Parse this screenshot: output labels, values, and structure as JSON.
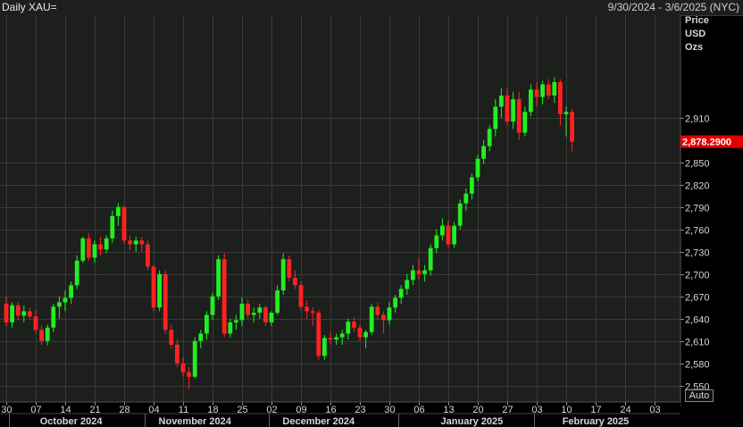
{
  "header": {
    "title": "Daily XAU=",
    "date_range": "9/30/2024 - 3/6/2025 (NYC)"
  },
  "price_axis": {
    "label_lines": [
      "Price",
      "USD",
      "Ozs"
    ]
  },
  "auto_label": "Auto",
  "chart_data": {
    "type": "candlestick",
    "instrument": "XAU=",
    "unit": "USD/Ozs",
    "last_price": "2,878.2900",
    "ylim": [
      2528,
      3048
    ],
    "y_ticks": [
      2550,
      2580,
      2610,
      2640,
      2670,
      2700,
      2730,
      2760,
      2790,
      2820,
      2850,
      2910
    ],
    "y_tick_labels": [
      "2,550",
      "2,580",
      "2,610",
      "2,640",
      "2,670",
      "2,700",
      "2,730",
      "2,760",
      "2,790",
      "2,820",
      "2,850",
      "2,910"
    ],
    "x_day_ticks": [
      {
        "label": "30",
        "index": 0
      },
      {
        "label": "07",
        "index": 5
      },
      {
        "label": "14",
        "index": 10
      },
      {
        "label": "21",
        "index": 15
      },
      {
        "label": "28",
        "index": 20
      },
      {
        "label": "04",
        "index": 25
      },
      {
        "label": "11",
        "index": 30
      },
      {
        "label": "18",
        "index": 35
      },
      {
        "label": "25",
        "index": 40
      },
      {
        "label": "02",
        "index": 45
      },
      {
        "label": "09",
        "index": 50
      },
      {
        "label": "16",
        "index": 55
      },
      {
        "label": "23",
        "index": 60
      },
      {
        "label": "30",
        "index": 65
      },
      {
        "label": "06",
        "index": 70
      },
      {
        "label": "13",
        "index": 75
      },
      {
        "label": "20",
        "index": 80
      },
      {
        "label": "27",
        "index": 85
      },
      {
        "label": "03",
        "index": 90
      },
      {
        "label": "10",
        "index": 95
      },
      {
        "label": "17",
        "index": 100
      },
      {
        "label": "24",
        "index": 105
      },
      {
        "label": "03",
        "index": 110
      }
    ],
    "x_months": [
      {
        "label": "October 2024",
        "index": 11
      },
      {
        "label": "November 2024",
        "index": 32
      },
      {
        "label": "December 2024",
        "index": 53
      },
      {
        "label": "January 2025",
        "index": 79
      },
      {
        "label": "February 2025",
        "index": 100
      }
    ],
    "month_boundaries": [
      1,
      24,
      45,
      67,
      90
    ],
    "colors": {
      "up": "#22ee22",
      "down": "#ff2222",
      "last_price_bg": "#e00000",
      "grid": "#3a3a3a"
    },
    "ohlc": [
      [
        2660,
        2670,
        2630,
        2635
      ],
      [
        2635,
        2662,
        2628,
        2658
      ],
      [
        2658,
        2662,
        2638,
        2644
      ],
      [
        2644,
        2658,
        2635,
        2650
      ],
      [
        2650,
        2655,
        2640,
        2643
      ],
      [
        2643,
        2652,
        2620,
        2625
      ],
      [
        2625,
        2632,
        2605,
        2610
      ],
      [
        2610,
        2632,
        2604,
        2628
      ],
      [
        2628,
        2660,
        2622,
        2656
      ],
      [
        2656,
        2670,
        2640,
        2662
      ],
      [
        2662,
        2678,
        2650,
        2668
      ],
      [
        2668,
        2690,
        2660,
        2685
      ],
      [
        2685,
        2725,
        2680,
        2718
      ],
      [
        2718,
        2750,
        2715,
        2748
      ],
      [
        2748,
        2755,
        2718,
        2722
      ],
      [
        2722,
        2745,
        2715,
        2740
      ],
      [
        2740,
        2750,
        2725,
        2733
      ],
      [
        2733,
        2752,
        2728,
        2748
      ],
      [
        2748,
        2785,
        2742,
        2778
      ],
      [
        2778,
        2795,
        2765,
        2790
      ],
      [
        2790,
        2792,
        2740,
        2745
      ],
      [
        2745,
        2752,
        2732,
        2740
      ],
      [
        2740,
        2750,
        2730,
        2745
      ],
      [
        2745,
        2750,
        2730,
        2740
      ],
      [
        2740,
        2745,
        2705,
        2710
      ],
      [
        2710,
        2712,
        2650,
        2655
      ],
      [
        2655,
        2705,
        2650,
        2700
      ],
      [
        2700,
        2705,
        2620,
        2625
      ],
      [
        2625,
        2632,
        2600,
        2605
      ],
      [
        2605,
        2612,
        2575,
        2580
      ],
      [
        2580,
        2588,
        2562,
        2568
      ],
      [
        2568,
        2575,
        2545,
        2562
      ],
      [
        2562,
        2615,
        2560,
        2610
      ],
      [
        2610,
        2625,
        2600,
        2620
      ],
      [
        2620,
        2650,
        2612,
        2645
      ],
      [
        2645,
        2675,
        2638,
        2670
      ],
      [
        2670,
        2725,
        2665,
        2720
      ],
      [
        2720,
        2728,
        2615,
        2620
      ],
      [
        2620,
        2640,
        2615,
        2635
      ],
      [
        2635,
        2645,
        2625,
        2638
      ],
      [
        2638,
        2668,
        2630,
        2660
      ],
      [
        2660,
        2665,
        2640,
        2645
      ],
      [
        2645,
        2655,
        2635,
        2648
      ],
      [
        2648,
        2660,
        2640,
        2655
      ],
      [
        2655,
        2658,
        2630,
        2635
      ],
      [
        2635,
        2650,
        2630,
        2648
      ],
      [
        2648,
        2685,
        2645,
        2678
      ],
      [
        2678,
        2728,
        2672,
        2720
      ],
      [
        2720,
        2725,
        2690,
        2695
      ],
      [
        2695,
        2705,
        2680,
        2685
      ],
      [
        2685,
        2690,
        2652,
        2656
      ],
      [
        2656,
        2665,
        2640,
        2650
      ],
      [
        2650,
        2655,
        2630,
        2648
      ],
      [
        2648,
        2652,
        2585,
        2590
      ],
      [
        2590,
        2618,
        2585,
        2614
      ],
      [
        2614,
        2622,
        2605,
        2612
      ],
      [
        2612,
        2620,
        2605,
        2615
      ],
      [
        2615,
        2625,
        2605,
        2620
      ],
      [
        2620,
        2640,
        2612,
        2636
      ],
      [
        2636,
        2642,
        2622,
        2628
      ],
      [
        2628,
        2632,
        2610,
        2615
      ],
      [
        2615,
        2625,
        2600,
        2622
      ],
      [
        2622,
        2660,
        2618,
        2656
      ],
      [
        2656,
        2662,
        2638,
        2645
      ],
      [
        2645,
        2650,
        2620,
        2638
      ],
      [
        2638,
        2662,
        2632,
        2655
      ],
      [
        2655,
        2672,
        2648,
        2668
      ],
      [
        2668,
        2685,
        2660,
        2680
      ],
      [
        2680,
        2700,
        2672,
        2692
      ],
      [
        2692,
        2712,
        2685,
        2705
      ],
      [
        2705,
        2722,
        2692,
        2700
      ],
      [
        2700,
        2712,
        2690,
        2705
      ],
      [
        2705,
        2740,
        2698,
        2735
      ],
      [
        2735,
        2760,
        2728,
        2752
      ],
      [
        2752,
        2775,
        2745,
        2765
      ],
      [
        2765,
        2772,
        2735,
        2740
      ],
      [
        2740,
        2770,
        2735,
        2765
      ],
      [
        2765,
        2800,
        2760,
        2795
      ],
      [
        2795,
        2815,
        2785,
        2808
      ],
      [
        2808,
        2835,
        2800,
        2830
      ],
      [
        2830,
        2860,
        2825,
        2855
      ],
      [
        2855,
        2880,
        2848,
        2872
      ],
      [
        2872,
        2900,
        2865,
        2895
      ],
      [
        2895,
        2935,
        2885,
        2925
      ],
      [
        2925,
        2950,
        2910,
        2940
      ],
      [
        2940,
        2950,
        2900,
        2905
      ],
      [
        2905,
        2945,
        2895,
        2935
      ],
      [
        2935,
        2945,
        2880,
        2890
      ],
      [
        2890,
        2925,
        2885,
        2918
      ],
      [
        2918,
        2955,
        2912,
        2948
      ],
      [
        2948,
        2958,
        2925,
        2938
      ],
      [
        2938,
        2960,
        2928,
        2955
      ],
      [
        2955,
        2962,
        2935,
        2940
      ],
      [
        2940,
        2965,
        2930,
        2958
      ],
      [
        2958,
        2962,
        2900,
        2915
      ],
      [
        2915,
        2925,
        2885,
        2918
      ],
      [
        2918,
        2922,
        2865,
        2878
      ]
    ]
  }
}
